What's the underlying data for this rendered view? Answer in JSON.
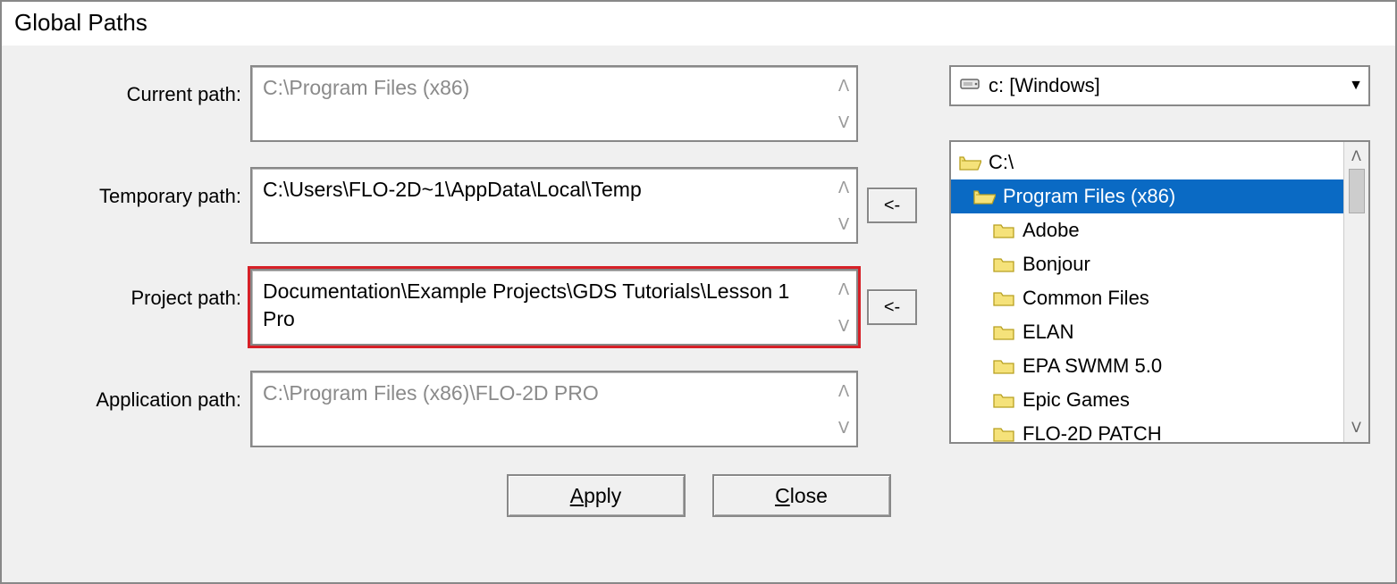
{
  "title": "Global Paths",
  "labels": {
    "current": "Current path:",
    "temporary": "Temporary path:",
    "project": "Project path:",
    "application": "Application path:"
  },
  "paths": {
    "current": "C:\\Program Files (x86)",
    "temporary": "C:\\Users\\FLO-2D~1\\AppData\\Local\\Temp",
    "project": "Documentation\\Example Projects\\GDS Tutorials\\Lesson 1 Pro",
    "application": "C:\\Program Files (x86)\\FLO-2D PRO"
  },
  "assign_label": "<-",
  "drive": {
    "text": "c: [Windows]"
  },
  "tree": [
    {
      "label": "C:\\",
      "indent": 0,
      "open": true,
      "selected": false
    },
    {
      "label": "Program Files (x86)",
      "indent": 1,
      "open": true,
      "selected": true
    },
    {
      "label": "Adobe",
      "indent": 2,
      "open": false,
      "selected": false
    },
    {
      "label": "Bonjour",
      "indent": 2,
      "open": false,
      "selected": false
    },
    {
      "label": "Common Files",
      "indent": 2,
      "open": false,
      "selected": false
    },
    {
      "label": "ELAN",
      "indent": 2,
      "open": false,
      "selected": false
    },
    {
      "label": "EPA SWMM 5.0",
      "indent": 2,
      "open": false,
      "selected": false
    },
    {
      "label": "Epic Games",
      "indent": 2,
      "open": false,
      "selected": false
    },
    {
      "label": "FLO-2D PATCH",
      "indent": 2,
      "open": false,
      "selected": false
    }
  ],
  "buttons": {
    "apply": "Apply",
    "close": "Close"
  }
}
